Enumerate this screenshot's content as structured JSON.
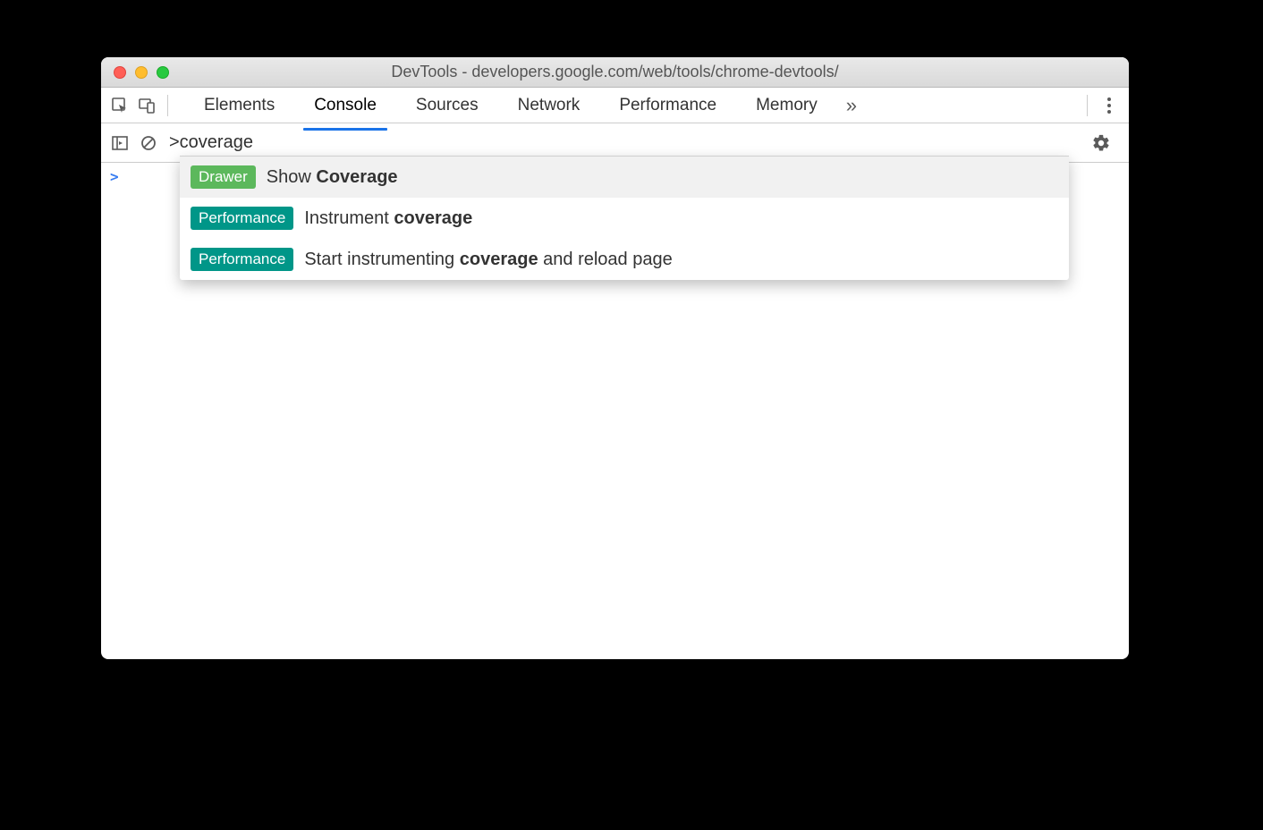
{
  "window": {
    "title": "DevTools - developers.google.com/web/tools/chrome-devtools/"
  },
  "tabs": {
    "items": [
      "Elements",
      "Console",
      "Sources",
      "Network",
      "Performance",
      "Memory"
    ],
    "active": "Console"
  },
  "command": {
    "input": ">coverage"
  },
  "results": [
    {
      "badge": "Drawer",
      "badgeColor": "green",
      "prefix": "Show ",
      "bold": "Coverage",
      "suffix": ""
    },
    {
      "badge": "Performance",
      "badgeColor": "teal",
      "prefix": "Instrument ",
      "bold": "coverage",
      "suffix": ""
    },
    {
      "badge": "Performance",
      "badgeColor": "teal",
      "prefix": "Start instrumenting ",
      "bold": "coverage",
      "suffix": " and reload page"
    }
  ],
  "console": {
    "prompt": ">"
  }
}
